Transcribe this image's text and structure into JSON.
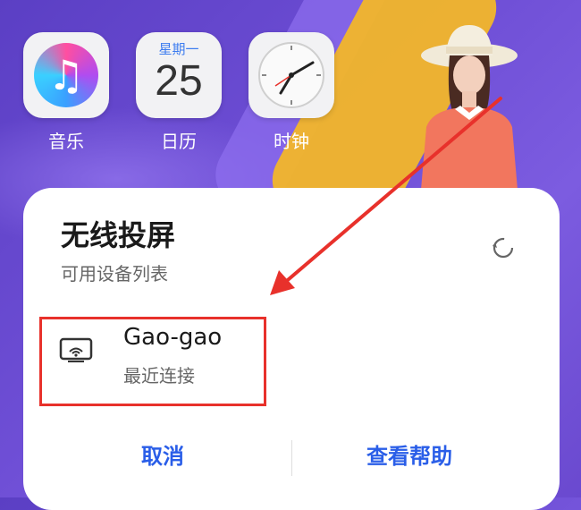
{
  "apps": [
    {
      "label": "音乐",
      "icon": "music-app-icon"
    },
    {
      "label": "日历",
      "icon": "calendar-app-icon",
      "weekday": "星期一",
      "day": "25"
    },
    {
      "label": "时钟",
      "icon": "clock-app-icon"
    }
  ],
  "dialog": {
    "title": "无线投屏",
    "subtitle": "可用设备列表",
    "device": {
      "name": "Gao-gao",
      "status": "最近连接"
    },
    "cancel_label": "取消",
    "help_label": "查看帮助"
  },
  "colors": {
    "accent": "#2a5ee8",
    "annotation": "#e8312b"
  }
}
